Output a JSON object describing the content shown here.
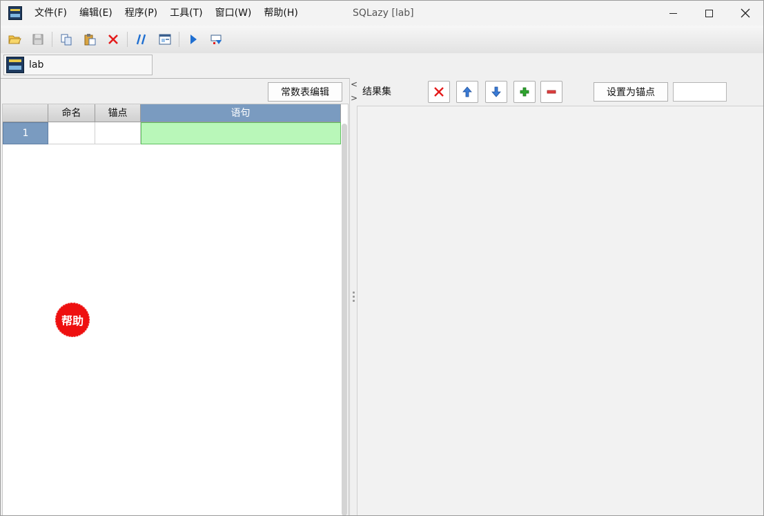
{
  "window": {
    "title": "SQLazy  [lab]"
  },
  "menu": {
    "items": [
      {
        "label": "文件(F)"
      },
      {
        "label": "编辑(E)"
      },
      {
        "label": "程序(P)"
      },
      {
        "label": "工具(T)"
      },
      {
        "label": "窗口(W)"
      },
      {
        "label": "帮助(H)"
      }
    ]
  },
  "toolbar": {
    "icons": [
      "open-folder-icon",
      "save-icon",
      "copy-icon",
      "paste-icon",
      "delete-icon",
      "comment-icon",
      "window-icon",
      "run-icon",
      "run-to-icon"
    ]
  },
  "doc_tab": {
    "label": "lab"
  },
  "left": {
    "const_button": "常数表编辑",
    "columns": [
      {
        "label": ""
      },
      {
        "label": "命名"
      },
      {
        "label": "锚点"
      },
      {
        "label": "语句"
      }
    ],
    "rows": [
      {
        "num": "1",
        "name": "",
        "anchor": "",
        "statement": ""
      }
    ],
    "help_badge": "帮助"
  },
  "right": {
    "result_label": "结果集",
    "anchor_button": "设置为锚点",
    "anchor_input_value": "",
    "colors": {
      "delete": "#e41b1b",
      "arrows": "#3a7bd5",
      "add": "#2fa52f",
      "remove": "#e04040"
    }
  },
  "colors": {
    "header_selected": "#7a9bc0",
    "edit_cell": "#b9f7b9",
    "help_badge": "#ee1010"
  }
}
